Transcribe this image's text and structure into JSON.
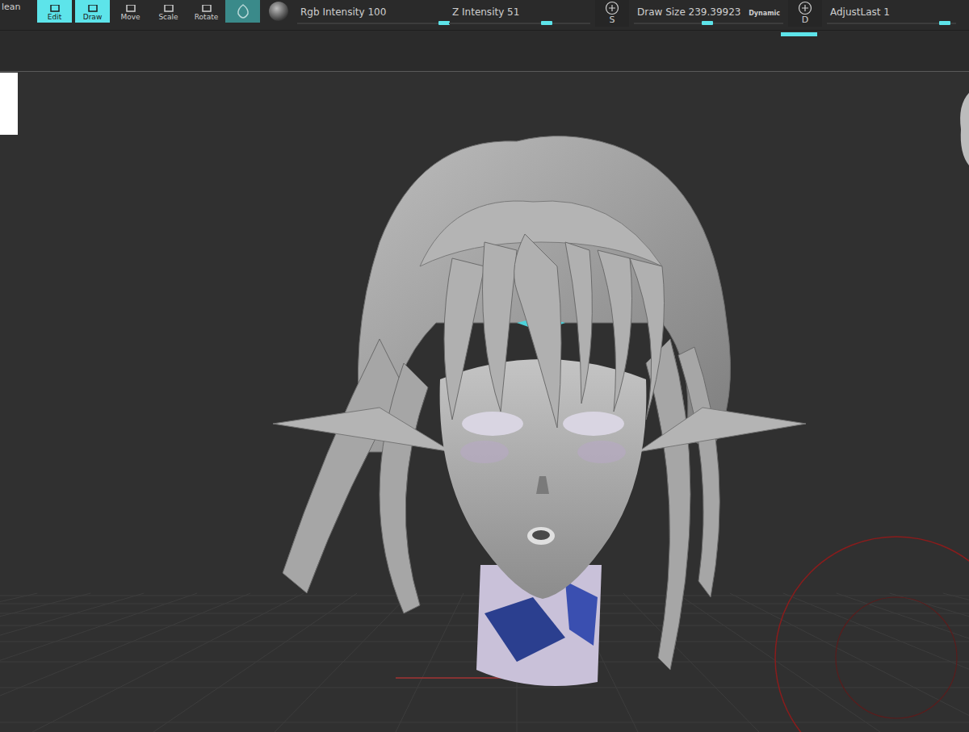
{
  "toolbar": {
    "cut_label": "lean",
    "tools": [
      {
        "label": "Edit",
        "selected": true
      },
      {
        "label": "Draw",
        "selected": true
      },
      {
        "label": "Move",
        "selected": false
      },
      {
        "label": "Scale",
        "selected": false
      },
      {
        "label": "Rotate",
        "selected": false
      }
    ],
    "modes": [
      {
        "kind": "brush",
        "selected": true
      },
      {
        "kind": "material",
        "selected": false
      }
    ],
    "controls": [
      {
        "kind": "slider",
        "label": "Rgb Intensity 100",
        "level": 1.0
      },
      {
        "kind": "slider",
        "label": "Z Intensity 51",
        "level": 0.69
      },
      {
        "kind": "button",
        "label": "S"
      },
      {
        "kind": "badged",
        "label": "Draw Size 239.39923",
        "badge": "Dynamic",
        "level": 0.49
      },
      {
        "kind": "button",
        "label": "D"
      },
      {
        "kind": "slider",
        "label": "AdjustLast 1",
        "level": 0.91
      }
    ]
  }
}
